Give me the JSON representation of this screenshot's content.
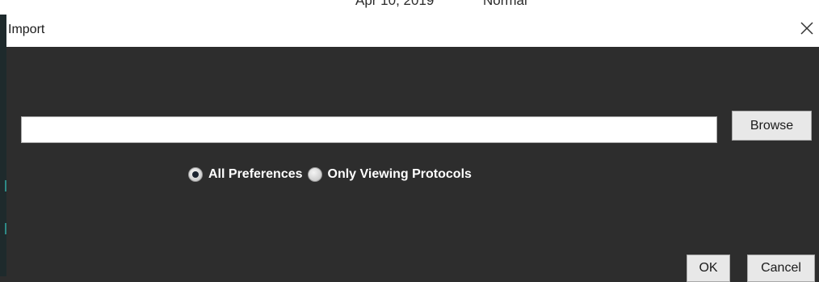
{
  "background_window": {
    "text_left": "Apr 10, 2019",
    "text_right": "Normal"
  },
  "dialog": {
    "title": "Import",
    "close_icon": "close-icon",
    "path_input": {
      "value": "",
      "placeholder": ""
    },
    "browse_label": "Browse",
    "radio_options": [
      {
        "label": "All Preferences",
        "selected": true
      },
      {
        "label": "Only Viewing Protocols",
        "selected": false
      }
    ],
    "ok_label": "OK",
    "cancel_label": "Cancel"
  },
  "colors": {
    "dialog_background": "#2d2d2d",
    "titlebar_background": "#ffffff",
    "button_background": "#e8e8e8",
    "radio_label_color": "#ffffff"
  }
}
